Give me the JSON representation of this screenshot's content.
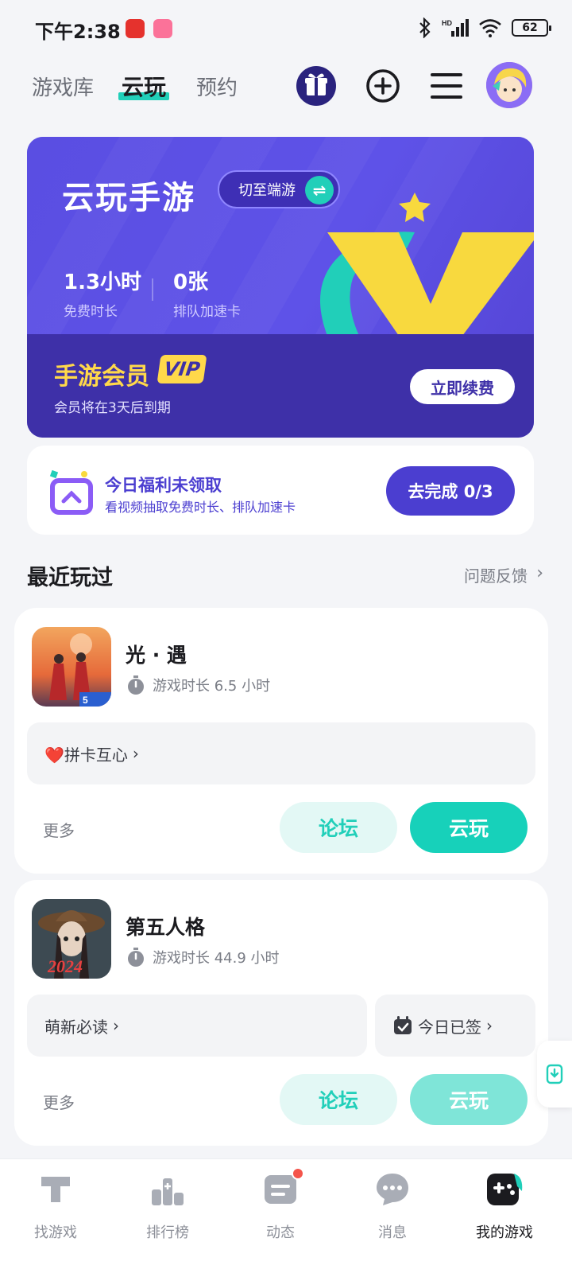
{
  "status_bar": {
    "time": "下午2:38",
    "battery": "62",
    "network": "HD"
  },
  "top_nav": {
    "tabs": [
      {
        "label": "游戏库"
      },
      {
        "label": "云玩",
        "active": true
      },
      {
        "label": "预约"
      }
    ]
  },
  "banner": {
    "title": "云玩手游",
    "switch_label": "切至端游",
    "stats": [
      {
        "value": "1.3小时",
        "label": "免费时长"
      },
      {
        "value": "0张",
        "label": "排队加速卡"
      }
    ],
    "vip_title": "手游会员",
    "vip_badge": "VIP",
    "vip_sub": "会员将在3天后到期",
    "renew_label": "立即续费",
    "colors": {
      "bg": "#5a4ee2",
      "bottom": "#3e30a8",
      "accent": "#ffd84a",
      "teal": "#21cfb9"
    }
  },
  "welfare": {
    "title": "今日福利未领取",
    "subtitle": "看视频抽取免费时长、排队加速卡",
    "button": "去完成 0/3"
  },
  "recent": {
    "title": "最近玩过",
    "feedback": "问题反馈",
    "games": [
      {
        "name": "光 · 遇",
        "playtime": "游戏时长 6.5 小时",
        "icon_badge": "5",
        "bars": [
          {
            "icon": "heart-icon",
            "label": "❤️拼卡互心"
          }
        ],
        "more": "更多",
        "forum": "论坛",
        "play": "云玩"
      },
      {
        "name": "第五人格",
        "playtime": "游戏时长 44.9 小时",
        "icon_badge": "2024",
        "bars": [
          {
            "label": "萌新必读"
          },
          {
            "icon": "calendar-check-icon",
            "label": "今日已签"
          }
        ],
        "more": "更多",
        "forum": "论坛",
        "play": "云玩"
      }
    ]
  },
  "bottom_nav": [
    {
      "label": "找游戏",
      "icon": "t-shape-icon"
    },
    {
      "label": "排行榜",
      "icon": "ranking-icon"
    },
    {
      "label": "动态",
      "icon": "feed-icon",
      "badge_dot": true
    },
    {
      "label": "消息",
      "icon": "chat-icon"
    },
    {
      "label": "我的游戏",
      "icon": "gamepad-icon",
      "active": true
    }
  ]
}
